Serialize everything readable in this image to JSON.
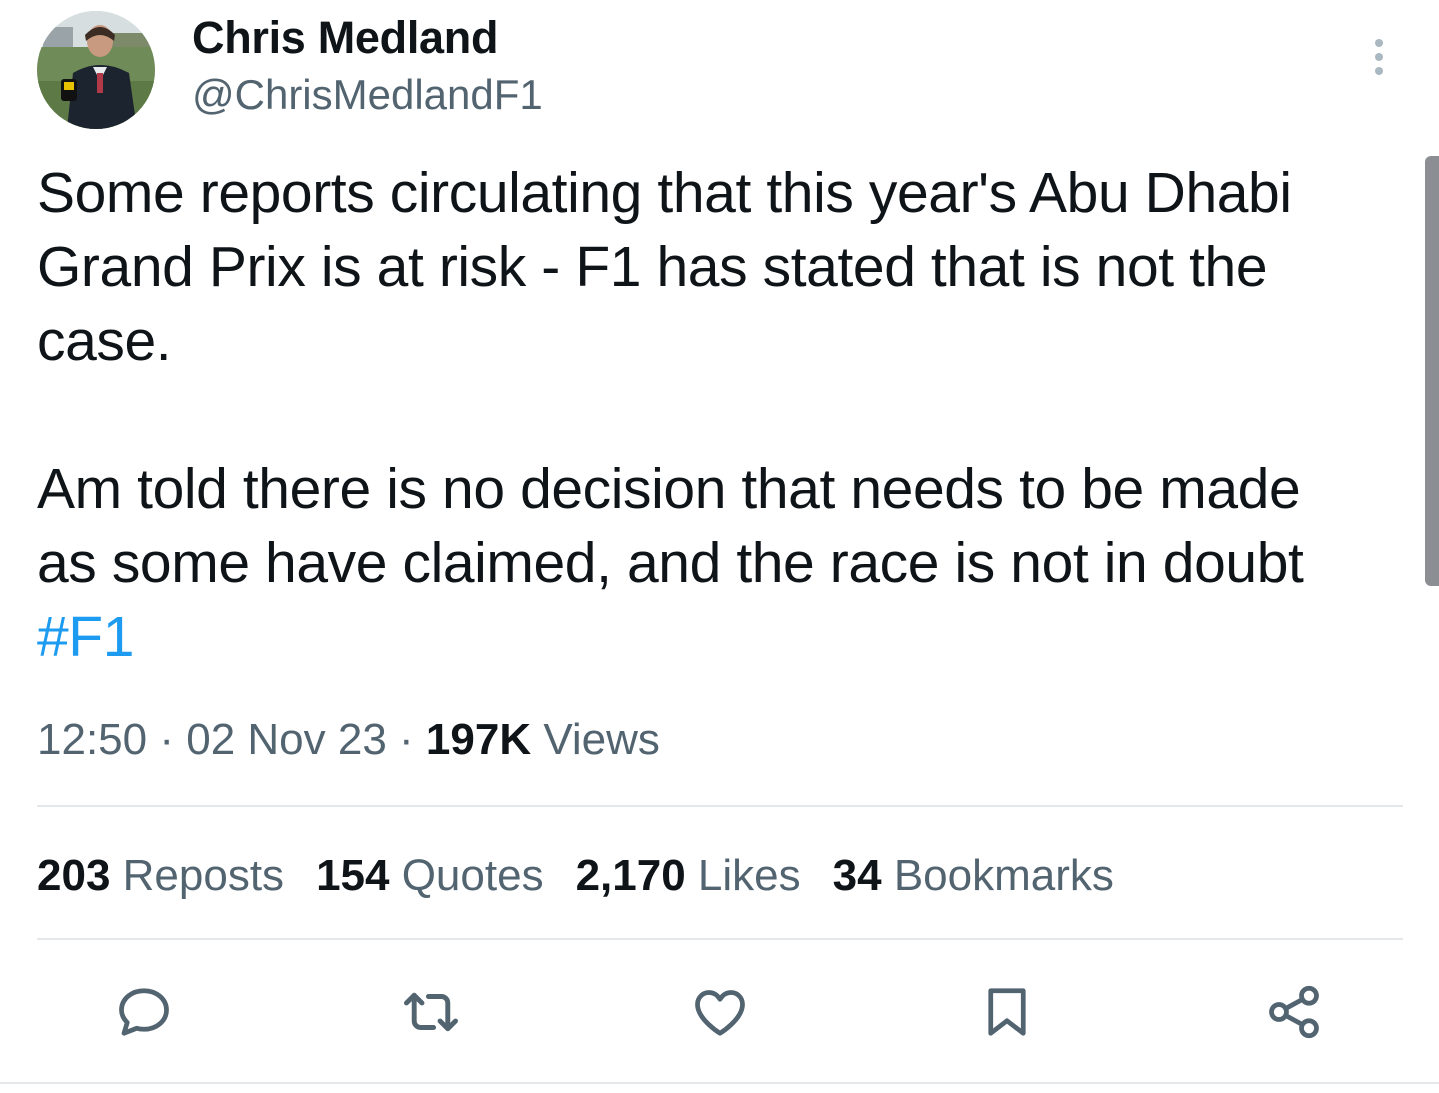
{
  "author": {
    "name": "Chris Medland",
    "handle": "@ChrisMedlandF1"
  },
  "tweet": {
    "line1": "Some reports circulating that this year's Abu Dhabi",
    "line2": "Grand Prix is at risk - F1 has stated that is not the",
    "line3": "case.",
    "line4": "Am told there is no decision that needs to be made",
    "line5": "as some have claimed, and the race is not in doubt",
    "hashtag": "#F1"
  },
  "meta": {
    "time": "12:50",
    "sep1": " · ",
    "date": "02 Nov 23",
    "sep2": " · ",
    "views_count": "197K",
    "views_label": " Views"
  },
  "stats": {
    "reposts_count": "203",
    "reposts_label": " Reposts",
    "quotes_count": "154",
    "quotes_label": " Quotes",
    "likes_count": "2,170",
    "likes_label": " Likes",
    "bookmarks_count": "34",
    "bookmarks_label": " Bookmarks"
  },
  "icons": {
    "reply": "reply-icon",
    "repost": "repost-icon",
    "like": "heart-icon",
    "bookmark": "bookmark-icon",
    "share": "share-icon",
    "more": "more-dots-icon"
  },
  "colors": {
    "text": "#0f1419",
    "secondary": "#536471",
    "link": "#1d9bf0",
    "divider": "#e4e8eb"
  }
}
